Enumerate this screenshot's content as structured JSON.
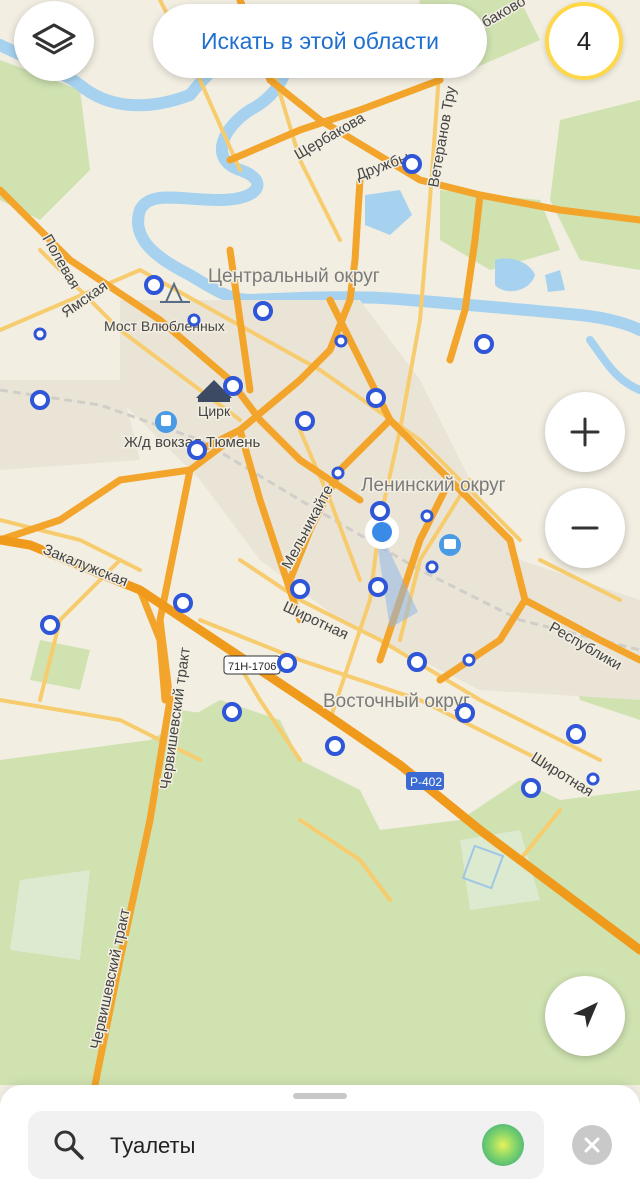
{
  "top_bar": {
    "search_area_label": "Искать в этой области",
    "counter": "4"
  },
  "map": {
    "districts": {
      "central": "Центральный округ",
      "leninsky": "Ленинский округ",
      "vostochny": "Восточный округ"
    },
    "streets": {
      "shcherbakova": "Щербакова",
      "druzhby": "Дружбы",
      "veteranov": "Ветеранов Тру",
      "polevaya": "Полевая",
      "yamskaya": "Ямская",
      "zaluzhskaya": "Закалужская",
      "melnikaite": "Мельникайте",
      "shirotnaya": "Широтная",
      "shirotnaya2": "Широтная",
      "respubliki": "Республики",
      "chervishevsky1": "Червишевский тракт",
      "chervishevsky2": "Червишевский тракт",
      "garbakovo": "рбаково"
    },
    "pois": {
      "bridge": "Мост Влюбленных",
      "circus": "Цирк",
      "station": "Ж/д вокзал Тюмень"
    },
    "road_signs": {
      "r402": "Р-402",
      "h71": "71Н-1706"
    }
  },
  "search": {
    "query": "Туалеты"
  },
  "colors": {
    "accent": "#1f6fcf",
    "marker": "#2f55d8",
    "road": "#f3a42a",
    "water": "#a6d2ef",
    "park": "#cfe2b0",
    "counter_ring": "#ffd84a"
  },
  "icons": {
    "layers": "layers-icon",
    "zoom_in": "plus-icon",
    "zoom_out": "minus-icon",
    "locate": "navigation-arrow-icon",
    "search": "magnifier-icon",
    "voice": "voice-assistant-icon",
    "clear": "close-icon"
  }
}
